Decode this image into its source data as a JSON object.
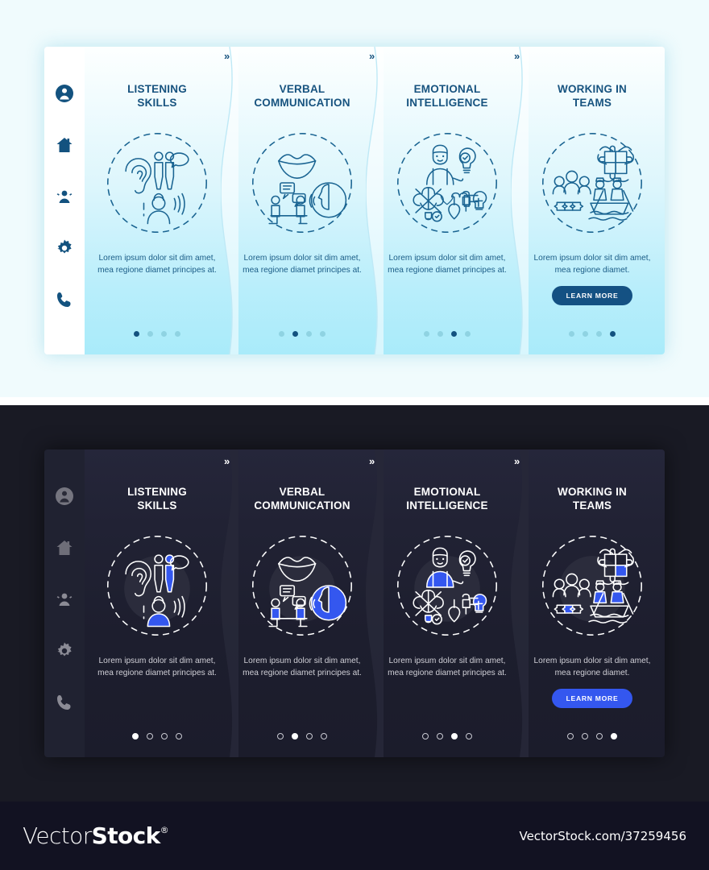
{
  "light_theme": {
    "accent": "#13527f",
    "background": "#f0fbfd",
    "sidebar_background": "#ffffff",
    "title_color": "#17537f",
    "button_color": "#145183"
  },
  "dark_theme": {
    "accent": "#3457ef",
    "background": "#191a24",
    "sidebar_background": "#202231",
    "title_color": "#ffffff",
    "button_color": "#3457ef"
  },
  "sidebar": {
    "items": [
      {
        "icon": "user-avatar-icon",
        "label": "Profile"
      },
      {
        "icon": "home-icon",
        "label": "Home"
      },
      {
        "icon": "group-people-icon",
        "label": "Team"
      },
      {
        "icon": "gear-icon",
        "label": "Settings"
      },
      {
        "icon": "phone-icon",
        "label": "Contact"
      }
    ]
  },
  "separator": "»",
  "cards": [
    {
      "title": "LISTENING\nSKILLS",
      "title_line1": "LISTENING",
      "title_line2": "SKILLS",
      "body": "Lorem ipsum dolor sit dim amet, mea regione diamet principes at.",
      "illustration": "ear-listening-people-icon",
      "dots": {
        "count": 4,
        "active": 0
      },
      "has_button": false,
      "button_label": ""
    },
    {
      "title": "VERBAL\nCOMMUNICATION",
      "title_line1": "VERBAL",
      "title_line2": "COMMUNICATION",
      "body": "Lorem ipsum dolor sit dim amet, mea regione diamet principes at.",
      "illustration": "lips-meeting-speaking-icon",
      "dots": {
        "count": 4,
        "active": 1
      },
      "has_button": false,
      "button_label": ""
    },
    {
      "title": "EMOTIONAL\nINTELLIGENCE",
      "title_line1": "EMOTIONAL",
      "title_line2": "INTELLIGENCE",
      "body": "Lorem ipsum dolor sit dim amet, mea regione diamet principes at.",
      "illustration": "person-lightbulb-brain-heart-icon",
      "dots": {
        "count": 4,
        "active": 2
      },
      "has_button": false,
      "button_label": ""
    },
    {
      "title": "WORKING IN\nTEAMS",
      "title_line1": "WORKING IN",
      "title_line2": "TEAMS",
      "body": "Lorem ipsum dolor sit dim amet, mea regione diamet.",
      "illustration": "team-puzzle-rowing-icon",
      "dots": {
        "count": 4,
        "active": 3
      },
      "has_button": true,
      "button_label": "LEARN MORE"
    }
  ],
  "footer": {
    "logo_part1": "Vector",
    "logo_part2": "Stock",
    "logo_registered": "®",
    "url": "VectorStock.com/37259456"
  }
}
